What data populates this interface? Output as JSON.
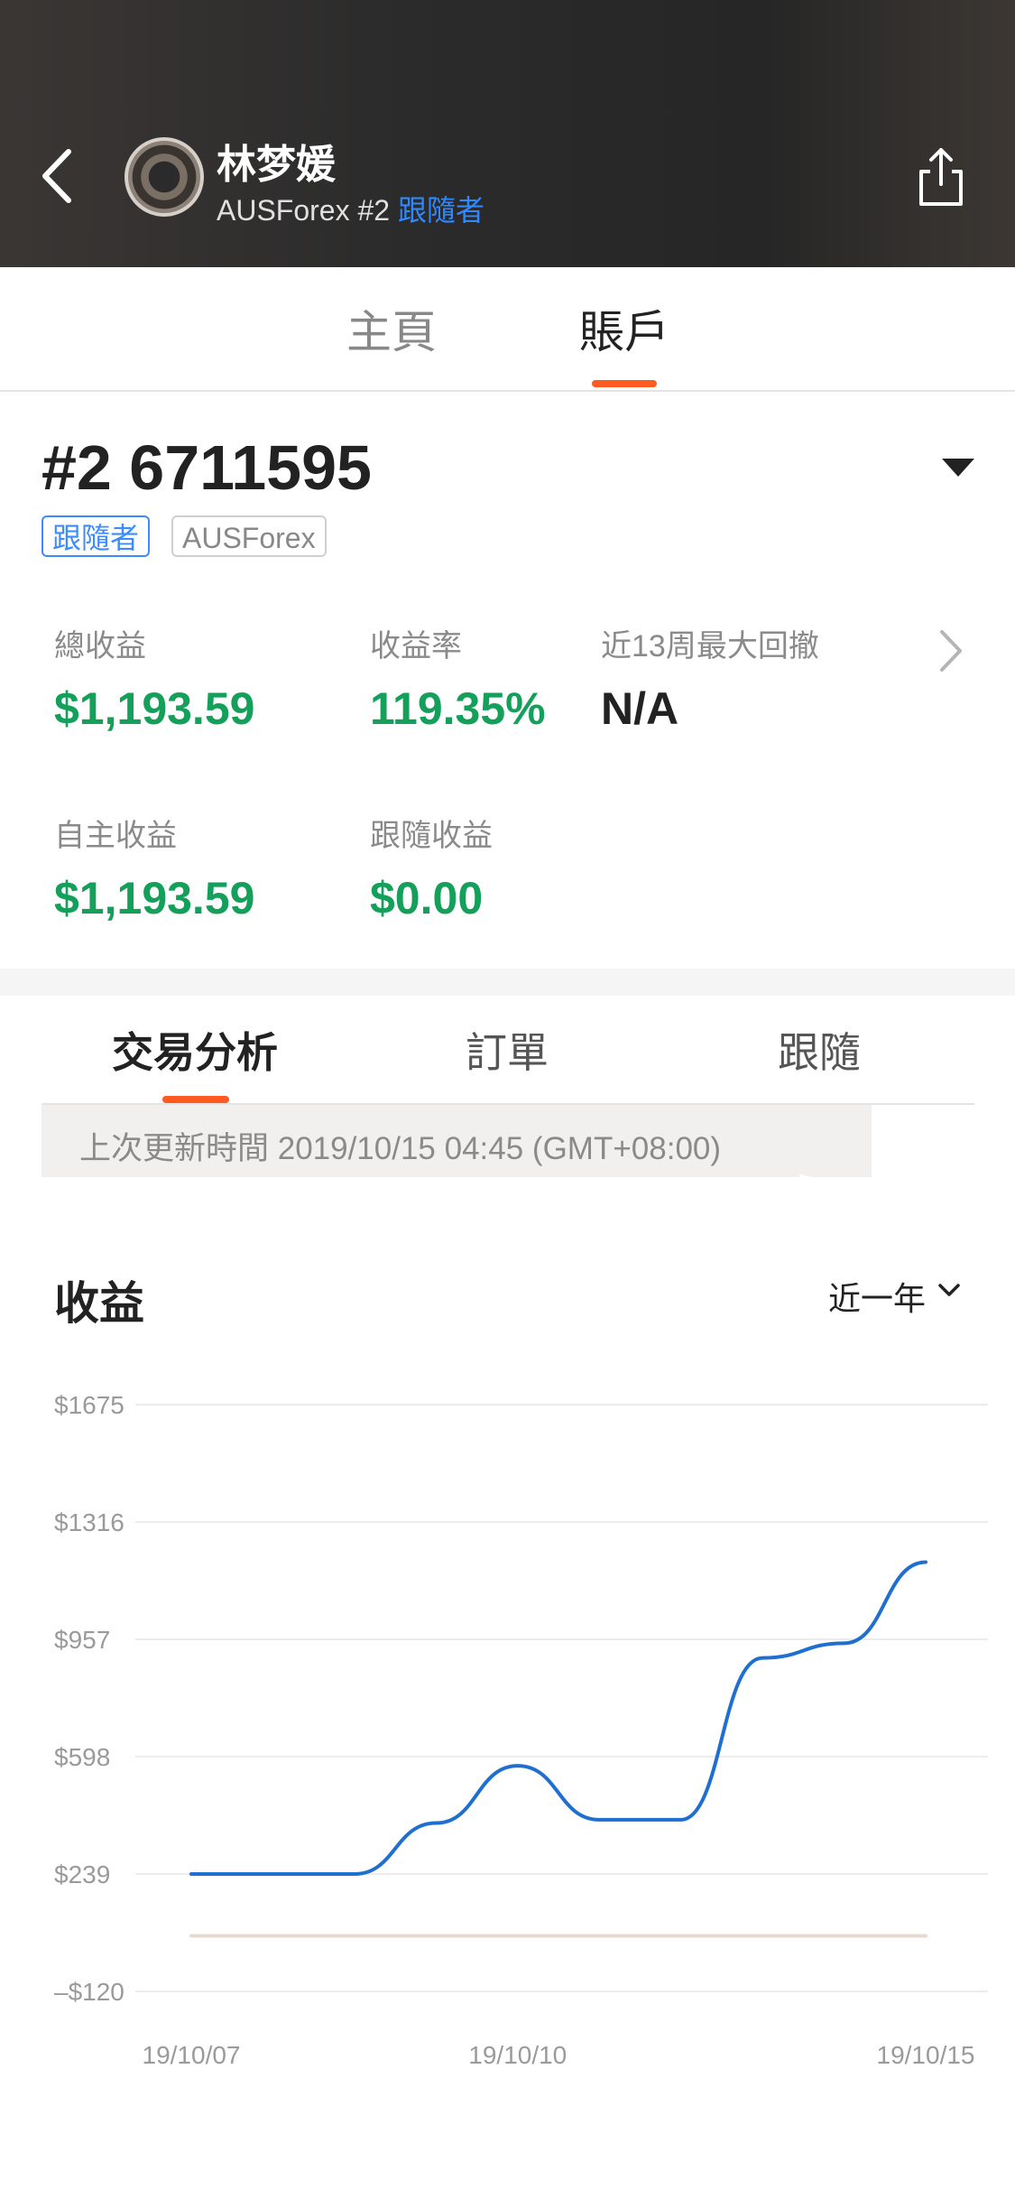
{
  "header": {
    "user_name": "林梦媛",
    "broker": "AUSForex",
    "account_index": "#2",
    "role": "跟隨者",
    "icons": {
      "back": "back-arrow-icon",
      "share": "share-icon",
      "avatar": "avatar"
    }
  },
  "main_tabs": [
    {
      "label": "主頁",
      "active": false
    },
    {
      "label": "賬戶",
      "active": true
    }
  ],
  "account": {
    "title": "#2 6711595",
    "tags": [
      "跟隨者",
      "AUSForex"
    ]
  },
  "stats": {
    "total_profit_label": "總收益",
    "total_profit_value": "$1,193.59",
    "return_rate_label": "收益率",
    "return_rate_value": "119.35%",
    "drawdown_label": "近13周最大回撤",
    "drawdown_value": "N/A",
    "self_profit_label": "自主收益",
    "self_profit_value": "$1,193.59",
    "follow_profit_label": "跟隨收益",
    "follow_profit_value": "$0.00"
  },
  "sub_tabs": [
    {
      "label": "交易分析",
      "active": true
    },
    {
      "label": "訂單",
      "active": false
    },
    {
      "label": "跟隨",
      "active": false
    }
  ],
  "update_time": "上次更新時間 2019/10/15 04:45 (GMT+08:00)",
  "chart_section": {
    "title": "收益",
    "period": "近一年"
  },
  "chart_data": {
    "type": "line",
    "y_ticks": [
      "$1675",
      "$1316",
      "$957",
      "$598",
      "$239",
      "–$120"
    ],
    "y_tick_values": [
      1675,
      1316,
      957,
      598,
      239,
      -120
    ],
    "ylim": [
      -120,
      1675
    ],
    "x_ticks": [
      "19/10/07",
      "19/10/10",
      "19/10/15"
    ],
    "x": [
      "19/10/07",
      "19/10/08",
      "19/10/08",
      "19/10/09",
      "19/10/10",
      "19/10/11",
      "19/10/12",
      "19/10/13",
      "19/10/14",
      "19/10/15"
    ],
    "series": [
      {
        "color": "#1f6fd1",
        "values": [
          239,
          239,
          239,
          395,
          570,
          405,
          405,
          900,
          945,
          1193
        ]
      },
      {
        "color": "#e8d8d2",
        "values": [
          50,
          50,
          50,
          50,
          50,
          50,
          50,
          50,
          50,
          50
        ]
      }
    ],
    "grid": true
  }
}
